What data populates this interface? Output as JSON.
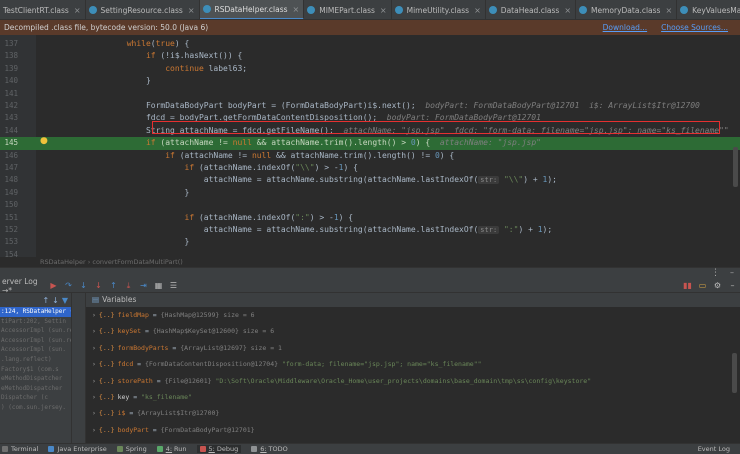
{
  "tabs": [
    {
      "label": "TestClientRT.class",
      "active": false
    },
    {
      "label": "SettingResource.class",
      "active": false
    },
    {
      "label": "RSDataHelper.class",
      "active": true
    },
    {
      "label": "MIMEPart.class",
      "active": false
    },
    {
      "label": "MimeUtility.class",
      "active": false
    },
    {
      "label": "DataHead.class",
      "active": false
    },
    {
      "label": "MemoryData.class",
      "active": false
    },
    {
      "label": "KeyValuesMapImpl.class",
      "active": false
    }
  ],
  "banner": {
    "text": "Decompiled .class file, bytecode version: 50.0 (Java 6)",
    "download": "Download...",
    "choose": "Choose Sources..."
  },
  "lines": [
    {
      "n": "137",
      "html": "<span class=\"kw\">                  while</span>(<span class=\"kw\">true</span>) {"
    },
    {
      "n": "138",
      "html": "                      <span class=\"kw\">if</span> (!i$.hasNext()) {"
    },
    {
      "n": "139",
      "html": "                          <span class=\"kw\">continue</span> label63;"
    },
    {
      "n": "140",
      "html": "                      }"
    },
    {
      "n": "141",
      "html": ""
    },
    {
      "n": "142",
      "html": "                      FormDataBodyPart bodyPart = (FormDataBodyPart)i$.next();  <span class=\"hint\">bodyPart: FormDataBodyPart@12701  i$: ArrayList$Itr@12700</span>"
    },
    {
      "n": "143",
      "html": "                      fdcd = bodyPart.getFormDataContentDisposition();  <span class=\"hint\">bodyPart: FormDataBodyPart@12701</span>"
    },
    {
      "n": "144",
      "html": "                      String attachName = fdcd.getFileName();  <span class=\"hint\">attachName: \"jsp.jsp\"  fdcd: \"form-data; filename=\"jsp.jsp\"; name=\"ks_filename\"\"</span>"
    },
    {
      "n": "145",
      "html": "                      <span class=\"kw\">if</span> (attachName != <span class=\"kw\">null</span> &amp;&amp; attachName.trim().length() &gt; <span class=\"num\">0</span>) {  <span class=\"hint\">attachName: \"jsp.jsp\"</span>",
      "exec": true
    },
    {
      "n": "146",
      "html": "                          <span class=\"kw\">if</span> (attachName != <span class=\"kw\">null</span> &amp;&amp; attachName.trim().length() != <span class=\"num\">0</span>) {"
    },
    {
      "n": "147",
      "html": "                              <span class=\"kw\">if</span> (attachName.indexOf(<span class=\"str\">\"\\\\\"</span>) &gt; -<span class=\"num\">1</span>) {"
    },
    {
      "n": "148",
      "html": "                                  attachName = attachName.substring(attachName.lastIndexOf(<span class=\"param\">str:</span> <span class=\"str\">\"\\\\\"</span>) + <span class=\"num\">1</span>);"
    },
    {
      "n": "149",
      "html": "                              }"
    },
    {
      "n": "150",
      "html": ""
    },
    {
      "n": "151",
      "html": "                              <span class=\"kw\">if</span> (attachName.indexOf(<span class=\"str\">\":\"</span>) &gt; -<span class=\"num\">1</span>) {"
    },
    {
      "n": "152",
      "html": "                                  attachName = attachName.substring(attachName.lastIndexOf(<span class=\"param\">str:</span> <span class=\"str\">\":\"</span>) + <span class=\"num\">1</span>);"
    },
    {
      "n": "153",
      "html": "                              }"
    },
    {
      "n": "154",
      "html": ""
    }
  ],
  "breadcrumbs": "RSDataHelper  ›  convertFormDataMultiPart()",
  "debug": {
    "tab_label": "erver Log →*",
    "variables_label": "Variables"
  },
  "frames": [
    {
      "text": ":124, RSDataHelper (c",
      "sel": true
    },
    {
      "text": "tiPart:202, Settin",
      "sel": false
    },
    {
      "text": "AccessorImpl (sun.re",
      "sel": false
    },
    {
      "text": "AccessorImpl (sun.re",
      "sel": false
    },
    {
      "text": "AccessorImpl (sun.",
      "sel": false
    },
    {
      "text": ".lang.reflect)",
      "sel": false
    },
    {
      "text": "Factory$1 (com.s",
      "sel": false
    },
    {
      "text": "eMethodDispatcher",
      "sel": false
    },
    {
      "text": "eMethodDispatcher",
      "sel": false
    },
    {
      "text": "Dispatcher (c",
      "sel": false
    },
    {
      "text": ") (com.sun.jersey.",
      "sel": false
    }
  ],
  "variables": [
    {
      "name": "fieldMap",
      "eq": " = ",
      "type": "{HashMap@12599}  size = 6",
      "val": ""
    },
    {
      "name": "keySet",
      "eq": " = ",
      "type": "{HashMap$KeySet@12600}  size = 6",
      "val": ""
    },
    {
      "name": "formBodyParts",
      "eq": " = ",
      "type": "{ArrayList@12697}  size = 1",
      "val": ""
    },
    {
      "name": "fdcd",
      "eq": " = ",
      "type": "{FormDataContentDisposition@12704} ",
      "val": "\"form-data; filename=\"jsp.jsp\"; name=\"ks_filename\"\""
    },
    {
      "name": "storePath",
      "eq": " = ",
      "type": "{File@12601} ",
      "val": "\"D:\\Soft\\Oracle\\Middleware\\Oracle_Home\\user_projects\\domains\\base_domain\\tmp\\ss\\config\\keystore\""
    },
    {
      "name": "key",
      "eq": " = ",
      "type": "",
      "val": "\"ks_filename\"",
      "plain": true
    },
    {
      "name": "i$",
      "eq": " = ",
      "type": "{ArrayList$Itr@12700}",
      "val": ""
    },
    {
      "name": "bodyPart",
      "eq": " = ",
      "type": "{FormDataBodyPart@12701}",
      "val": ""
    }
  ],
  "status": {
    "items": [
      {
        "label": "Terminal",
        "u": "",
        "color": "#707070"
      },
      {
        "label": "Java Enterprise",
        "u": "",
        "color": "#4a88c7"
      },
      {
        "label": "Spring",
        "u": "",
        "color": "#6a8759"
      },
      {
        "label": "Run",
        "u": "4:",
        "color": "#59a869"
      },
      {
        "label": "Debug",
        "u": "5:",
        "color": "#c75450",
        "active": true
      },
      {
        "label": "TODO",
        "u": "6:",
        "color": "#8f9294"
      }
    ],
    "event_log": "Event Log"
  }
}
